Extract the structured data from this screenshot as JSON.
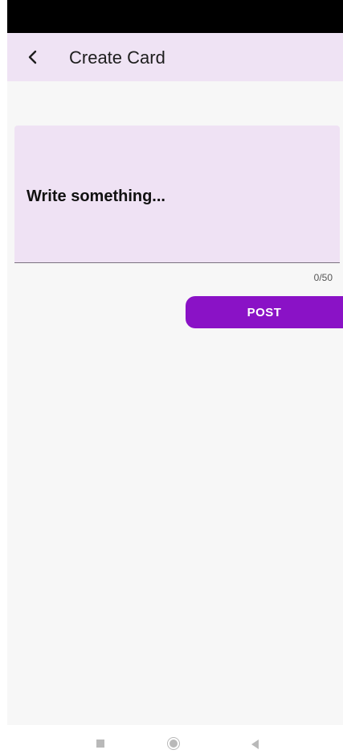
{
  "app_bar": {
    "back_icon": "chevron-left-icon",
    "title": "Create Card",
    "background": "#efe3f4"
  },
  "card_input": {
    "value": "Write something...",
    "counter": "0/50",
    "max_length": 50
  },
  "actions": {
    "post_label": "POST",
    "post_color": "#8a12c6"
  },
  "system_nav": {
    "recents_icon": "square-icon",
    "home_icon": "circle-home-icon",
    "back_icon": "triangle-back-icon"
  }
}
